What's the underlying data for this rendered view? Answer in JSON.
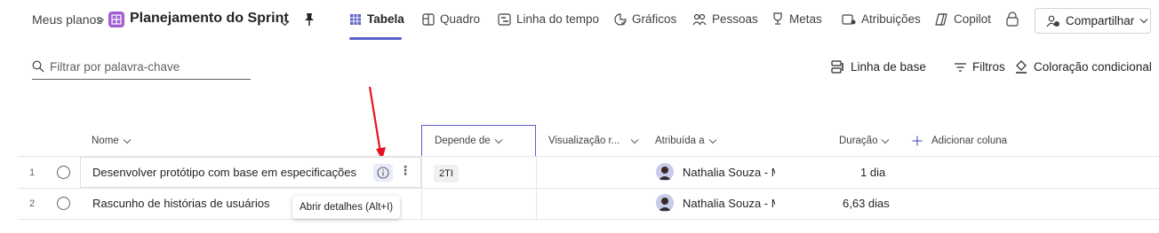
{
  "breadcrumb": {
    "parent": "Meus planos",
    "separator": ">"
  },
  "plan": {
    "title": "Planejamento do Sprint",
    "icon_color": "#a05ed1"
  },
  "views": [
    {
      "label": "Tabela",
      "icon": "table-icon",
      "active": true
    },
    {
      "label": "Quadro",
      "icon": "board-icon"
    },
    {
      "label": "Linha do tempo",
      "icon": "timeline-icon"
    },
    {
      "label": "Gráficos",
      "icon": "charts-icon"
    },
    {
      "label": "Pessoas",
      "icon": "people-icon"
    },
    {
      "label": "Metas",
      "icon": "goals-icon"
    },
    {
      "label": "Atribuições",
      "icon": "assignments-icon"
    },
    {
      "label": "Copilot",
      "icon": "copilot-icon"
    }
  ],
  "share": {
    "label": "Compartilhar"
  },
  "filter": {
    "placeholder": "Filtrar por palavra-chave"
  },
  "tools": {
    "baseline": "Linha de base",
    "filters": "Filtros",
    "conditional": "Coloração condicional"
  },
  "columns": {
    "name": "Nome",
    "depends": "Depende de",
    "visualization": "Visualização r...",
    "assigned": "Atribuída a",
    "duration": "Duração",
    "add": "Adicionar coluna"
  },
  "rows": [
    {
      "num": "1",
      "name": "Desenvolver protótipo com base em especificações",
      "depends": "2TI",
      "assignee": "Nathalia Souza - M",
      "duration": "1 dia"
    },
    {
      "num": "2",
      "name": "Rascunho de histórias de usuários",
      "depends": "",
      "assignee": "Nathalia Souza - M",
      "duration": "6,63 dias"
    }
  ],
  "tooltip": "Abrir detalhes (Alt+I)",
  "colors": {
    "accent": "#5b5fc7",
    "annotation": "#e81123"
  }
}
